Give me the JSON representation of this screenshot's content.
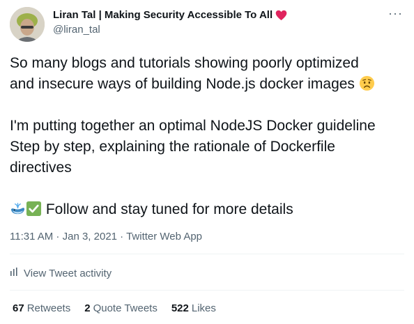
{
  "author": {
    "display_name": "Liran Tal | Making Security Accessible To All",
    "handle": "@liran_tal",
    "name_emoji_icon": "red-heart-icon"
  },
  "menu": {
    "more_label": "···"
  },
  "tweet": {
    "line1": "So many blogs and tutorials showing poorly optimized",
    "line2": "and insecure ways of building Node.js docker images",
    "line2_emoji_icon": "worried-face-icon",
    "para2_line1": "I'm putting together an optimal NodeJS Docker guideline",
    "para2_line2": "Step by step, explaining the rationale of Dockerfile",
    "para2_line3": "directives",
    "para3_emoji_icons": [
      "spouting-whale-icon",
      "check-mark-button-icon"
    ],
    "para3_text": "Follow and stay tuned for more details"
  },
  "meta": {
    "time": "11:31 AM",
    "sep1": " · ",
    "date": "Jan 3, 2021",
    "sep2": " · ",
    "source": "Twitter Web App"
  },
  "activity": {
    "label": "View Tweet activity",
    "icon": "bar-chart-icon"
  },
  "stats": {
    "retweets_count": "67",
    "retweets_label": "Retweets",
    "quotes_count": "2",
    "quotes_label": "Quote Tweets",
    "likes_count": "522",
    "likes_label": "Likes"
  },
  "colors": {
    "text_primary": "#0f1419",
    "text_secondary": "#536471",
    "divider": "#eff3f4",
    "heart": "#e0245e",
    "check_green": "#77b255"
  }
}
